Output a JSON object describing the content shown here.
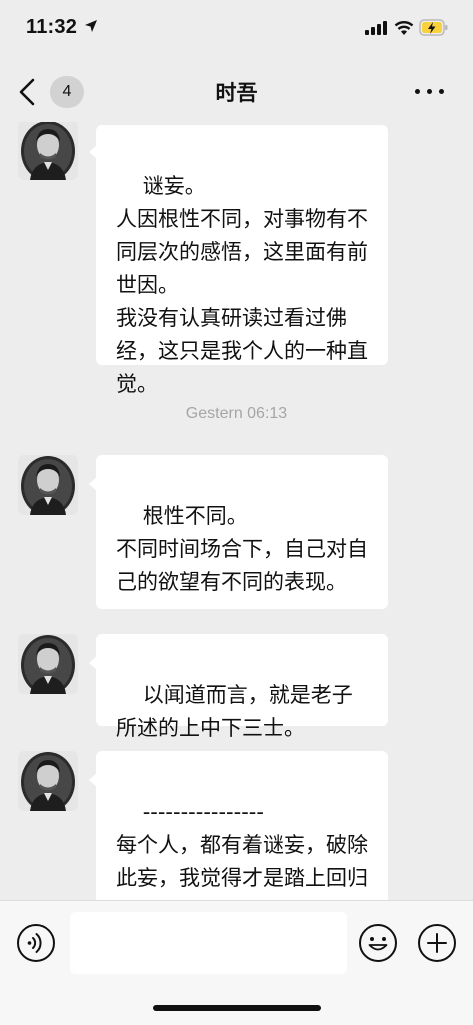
{
  "status_bar": {
    "time": "11:32"
  },
  "nav": {
    "badge_count": "4",
    "title": "时吾"
  },
  "messages": [
    {
      "text": "谜妄。\n人因根性不同，对事物有不同层次的感悟，这里面有前世因。\n我没有认真研读过看过佛经，这只是我个人的一种直觉。"
    },
    {
      "text": "根性不同。\n不同时间场合下，自己对自己的欲望有不同的表现。"
    },
    {
      "text": "以闻道而言，就是老子所述的上中下三士。"
    },
    {
      "text": "----------------\n每个人，都有着谜妄，破除此妄，我觉得才是踏上回归的第一步。"
    }
  ],
  "timestamp": "Gestern 06:13",
  "input": {
    "value": ""
  },
  "colors": {
    "background": "#ededed",
    "bubble": "#ffffff",
    "battery": "#f7d23c"
  }
}
